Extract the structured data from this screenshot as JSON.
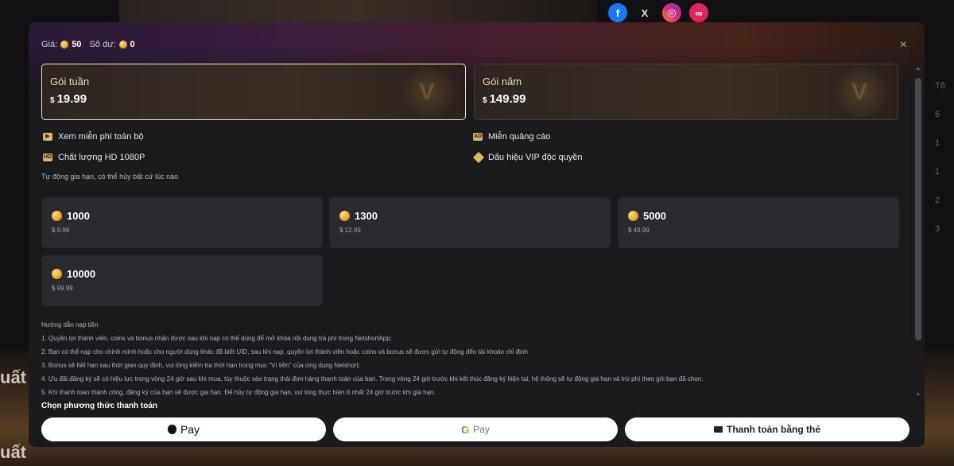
{
  "background": {
    "side_text_1": "uất",
    "side_text_2": "uất",
    "social": [
      {
        "name": "facebook-icon",
        "glyph": "f"
      },
      {
        "name": "x-icon",
        "glyph": "X"
      },
      {
        "name": "instagram-icon",
        "glyph": "◎"
      },
      {
        "name": "link-icon",
        "glyph": "∞"
      }
    ],
    "right_col": [
      "Tô",
      "6",
      "1",
      "1",
      "2",
      "3"
    ]
  },
  "header": {
    "price_label": "Giá:",
    "price_value": "50",
    "balance_label": "Số dư:",
    "balance_value": "0",
    "close_glyph": "×"
  },
  "plans": [
    {
      "name": "Gói tuần",
      "currency": "$",
      "price": "19.99",
      "active": true
    },
    {
      "name": "Gói năm",
      "currency": "$",
      "price": "149.99",
      "active": false
    }
  ],
  "benefits": [
    {
      "label": "Xem miễn phí toàn bộ",
      "icon": "play-icon"
    },
    {
      "label": "Chất lượng HD 1080P",
      "icon": "hd-icon"
    },
    {
      "label": "Miễn quảng cáo",
      "icon": "ad-free-icon"
    },
    {
      "label": "Dấu hiệu VIP độc quyền",
      "icon": "vip-diamond-icon"
    }
  ],
  "auto_renew_note": "Tự động gia hạn, có thể hủy bất cứ lúc nào",
  "coin_packages": [
    {
      "amount": "1000",
      "price": "$ 9.99"
    },
    {
      "amount": "1300",
      "price": "$ 12.99"
    },
    {
      "amount": "5000",
      "price": "$ 49.99"
    },
    {
      "amount": "10000",
      "price": "$ 99.99"
    }
  ],
  "guide": {
    "title": "Hướng dẫn nạp tiền",
    "lines": [
      "1. Quyền lợi thành viên, coins và bonus nhận được sau khi nạp có thể dùng để mở khóa nội dung trả phí trong NetshortApp;",
      "2. Bạn có thể nạp cho chính mình hoặc cho người dùng khác đã biết UID, sau khi nạp, quyền lợi thành viên hoặc coins và bonus sẽ được gửi tự động đến tài khoản chỉ định",
      "3. Bonus sẽ hết hạn sau thời gian quy định, vui lòng kiểm tra thời hạn trong mục \"Ví tiền\" của ứng dụng Netshort;",
      "4. Ưu đãi đăng ký sẽ có hiệu lực trong vòng 24 giờ sau khi mua, tùy thuộc vào trạng thái đơn hàng thanh toán của bạn. Trong vòng 24 giờ trước khi kết thúc đăng ký hiện tại, hệ thống sẽ tự động gia hạn và trừ phí theo gói bạn đã chọn.",
      "5. Khi thanh toán thành công, đăng ký của bạn sẽ được gia hạn. Để hủy tự động gia hạn, vui lòng thực hiện ít nhất 24 giờ trước khi gia hạn."
    ]
  },
  "payment": {
    "label": "Chọn phương thức thanh toán",
    "apple_pay": "Pay",
    "google_g": "G",
    "google_pay": "Pay",
    "card": "Thanh toán bằng thẻ"
  }
}
